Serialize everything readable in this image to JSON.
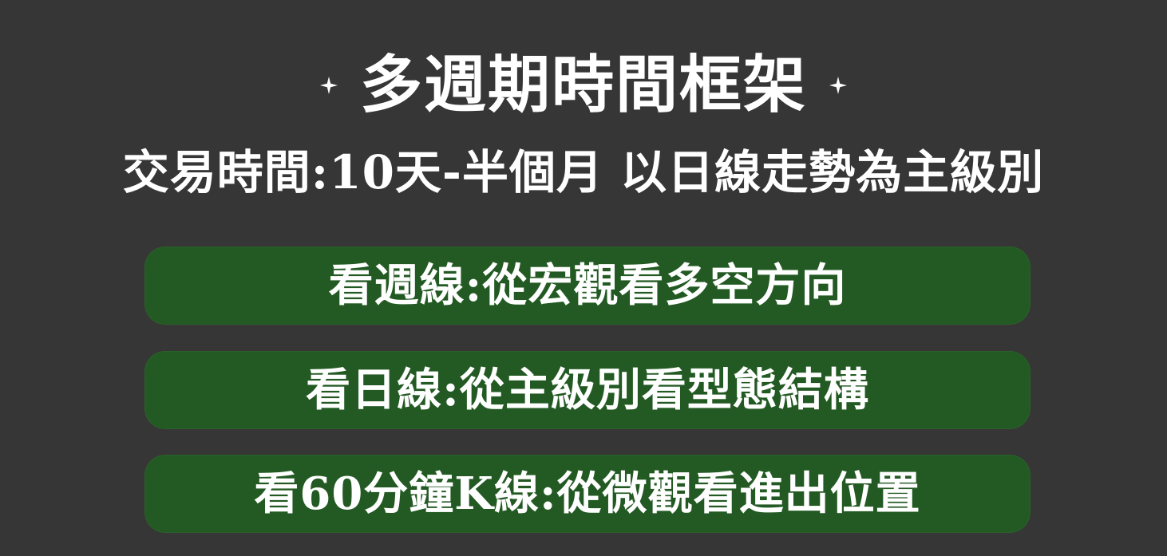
{
  "title": "多週期時間框架",
  "title_icon": "sparkle-icon",
  "subtitle": "交易時間:10天-半個月 以日線走勢為主級別",
  "bars": [
    {
      "text": "看週線:從宏觀看多空方向"
    },
    {
      "text": "看日線:從主級別看型態結構"
    },
    {
      "text": "看60分鐘K線:從微觀看進出位置"
    }
  ],
  "colors": {
    "background": "#363636",
    "bar": "#235a23",
    "text": "#ffffff"
  }
}
